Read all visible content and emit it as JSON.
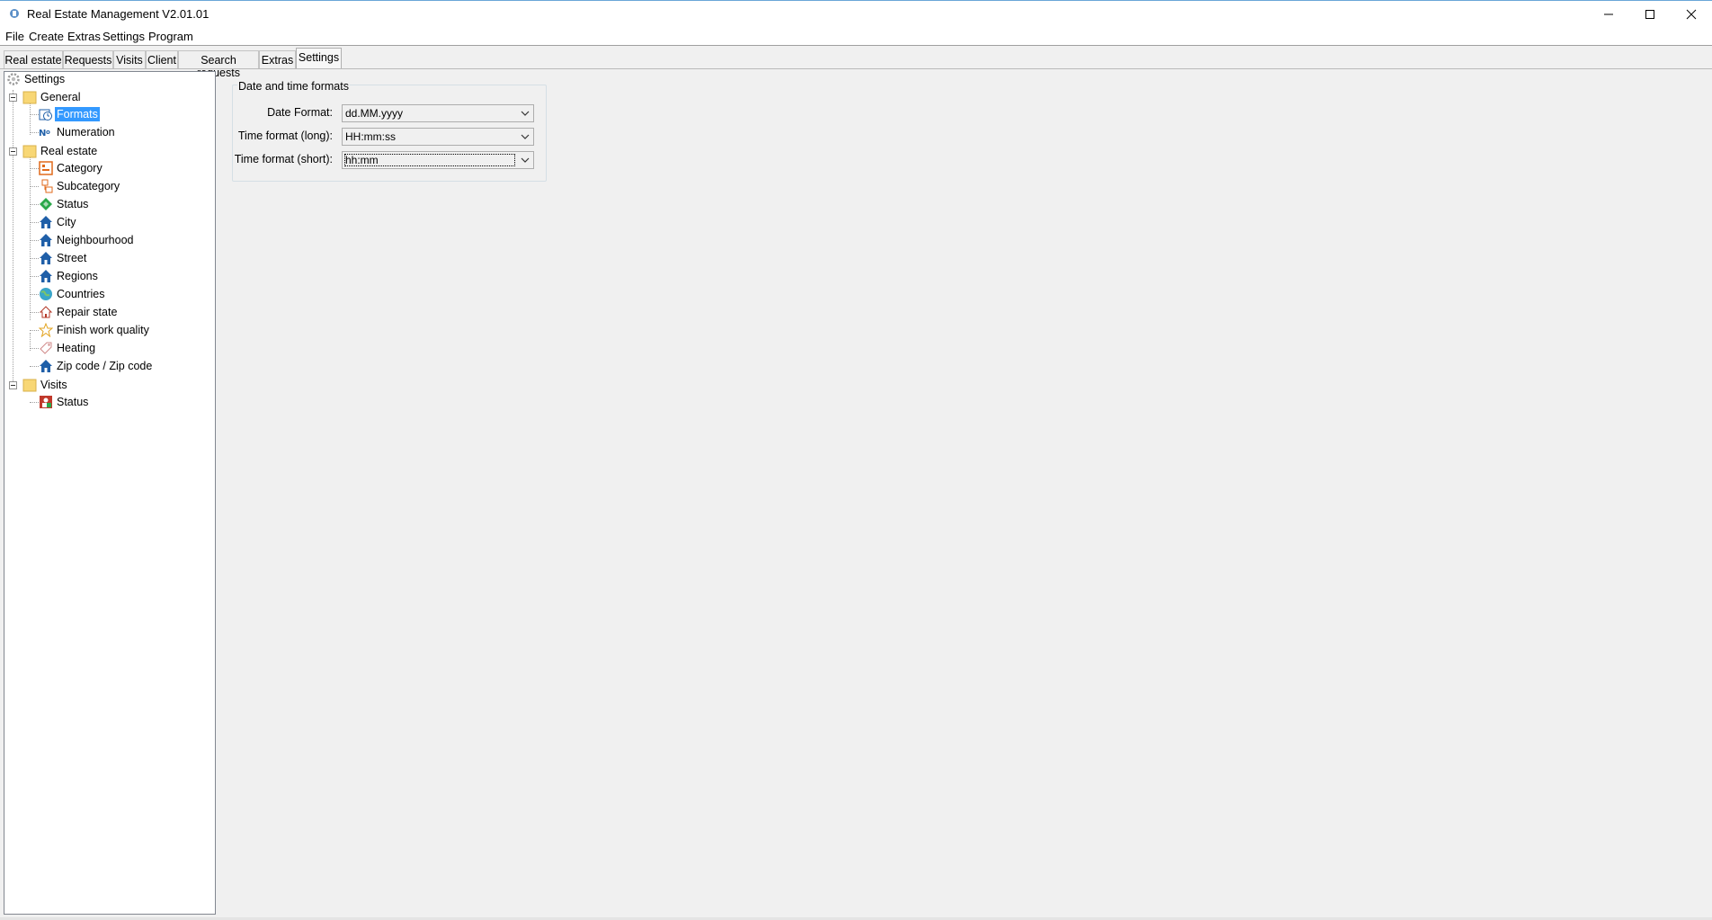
{
  "window": {
    "title": "Real Estate Management V2.01.01",
    "controls": [
      "minimize",
      "maximize",
      "close"
    ]
  },
  "menu": [
    "File",
    "Create",
    "Extras",
    "Settings",
    "Program"
  ],
  "tabs": [
    {
      "label": "Real estate",
      "active": false
    },
    {
      "label": "Requests",
      "active": false
    },
    {
      "label": "Visits",
      "active": false
    },
    {
      "label": "Client",
      "active": false
    },
    {
      "label": "Search requests",
      "active": false
    },
    {
      "label": "Extras",
      "active": false
    },
    {
      "label": "Settings",
      "active": true
    }
  ],
  "tree": {
    "root": "Settings",
    "general": {
      "label": "General",
      "items": [
        {
          "label": "Formats",
          "icon": "formats-icon",
          "selected": true
        },
        {
          "label": "Numeration",
          "icon": "numero-icon"
        }
      ]
    },
    "real_estate": {
      "label": "Real estate",
      "items": [
        {
          "label": "Category",
          "icon": "category-icon"
        },
        {
          "label": "Subcategory",
          "icon": "subcategory-icon"
        },
        {
          "label": "Status",
          "icon": "status-diamond-icon"
        },
        {
          "label": "City",
          "icon": "house-icon"
        },
        {
          "label": "Neighbourhood",
          "icon": "house-icon"
        },
        {
          "label": "Street",
          "icon": "house-icon"
        },
        {
          "label": "Regions",
          "icon": "house-icon"
        },
        {
          "label": "Countries",
          "icon": "globe-icon"
        },
        {
          "label": "Repair state",
          "icon": "house-outline-icon"
        },
        {
          "label": "Finish work quality",
          "icon": "star-icon"
        },
        {
          "label": "Heating",
          "icon": "tag-icon"
        },
        {
          "label": "Zip code / Zip code",
          "icon": "house-icon"
        }
      ]
    },
    "visits": {
      "label": "Visits",
      "items": [
        {
          "label": "Status",
          "icon": "visit-status-icon"
        }
      ]
    }
  },
  "formats": {
    "group_title": "Date and time formats",
    "date_format_label": "Date Format:",
    "date_format_value": "dd.MM.yyyy",
    "time_long_label": "Time format (long):",
    "time_long_value": "HH:mm:ss",
    "time_short_label": "Time format (short):",
    "time_short_value": "hh:mm"
  },
  "colors": {
    "selection": "#3399ff",
    "house_blue": "#1f5fa8",
    "folder_yellow": "#f8d775",
    "accent_orange": "#e06a1b"
  }
}
